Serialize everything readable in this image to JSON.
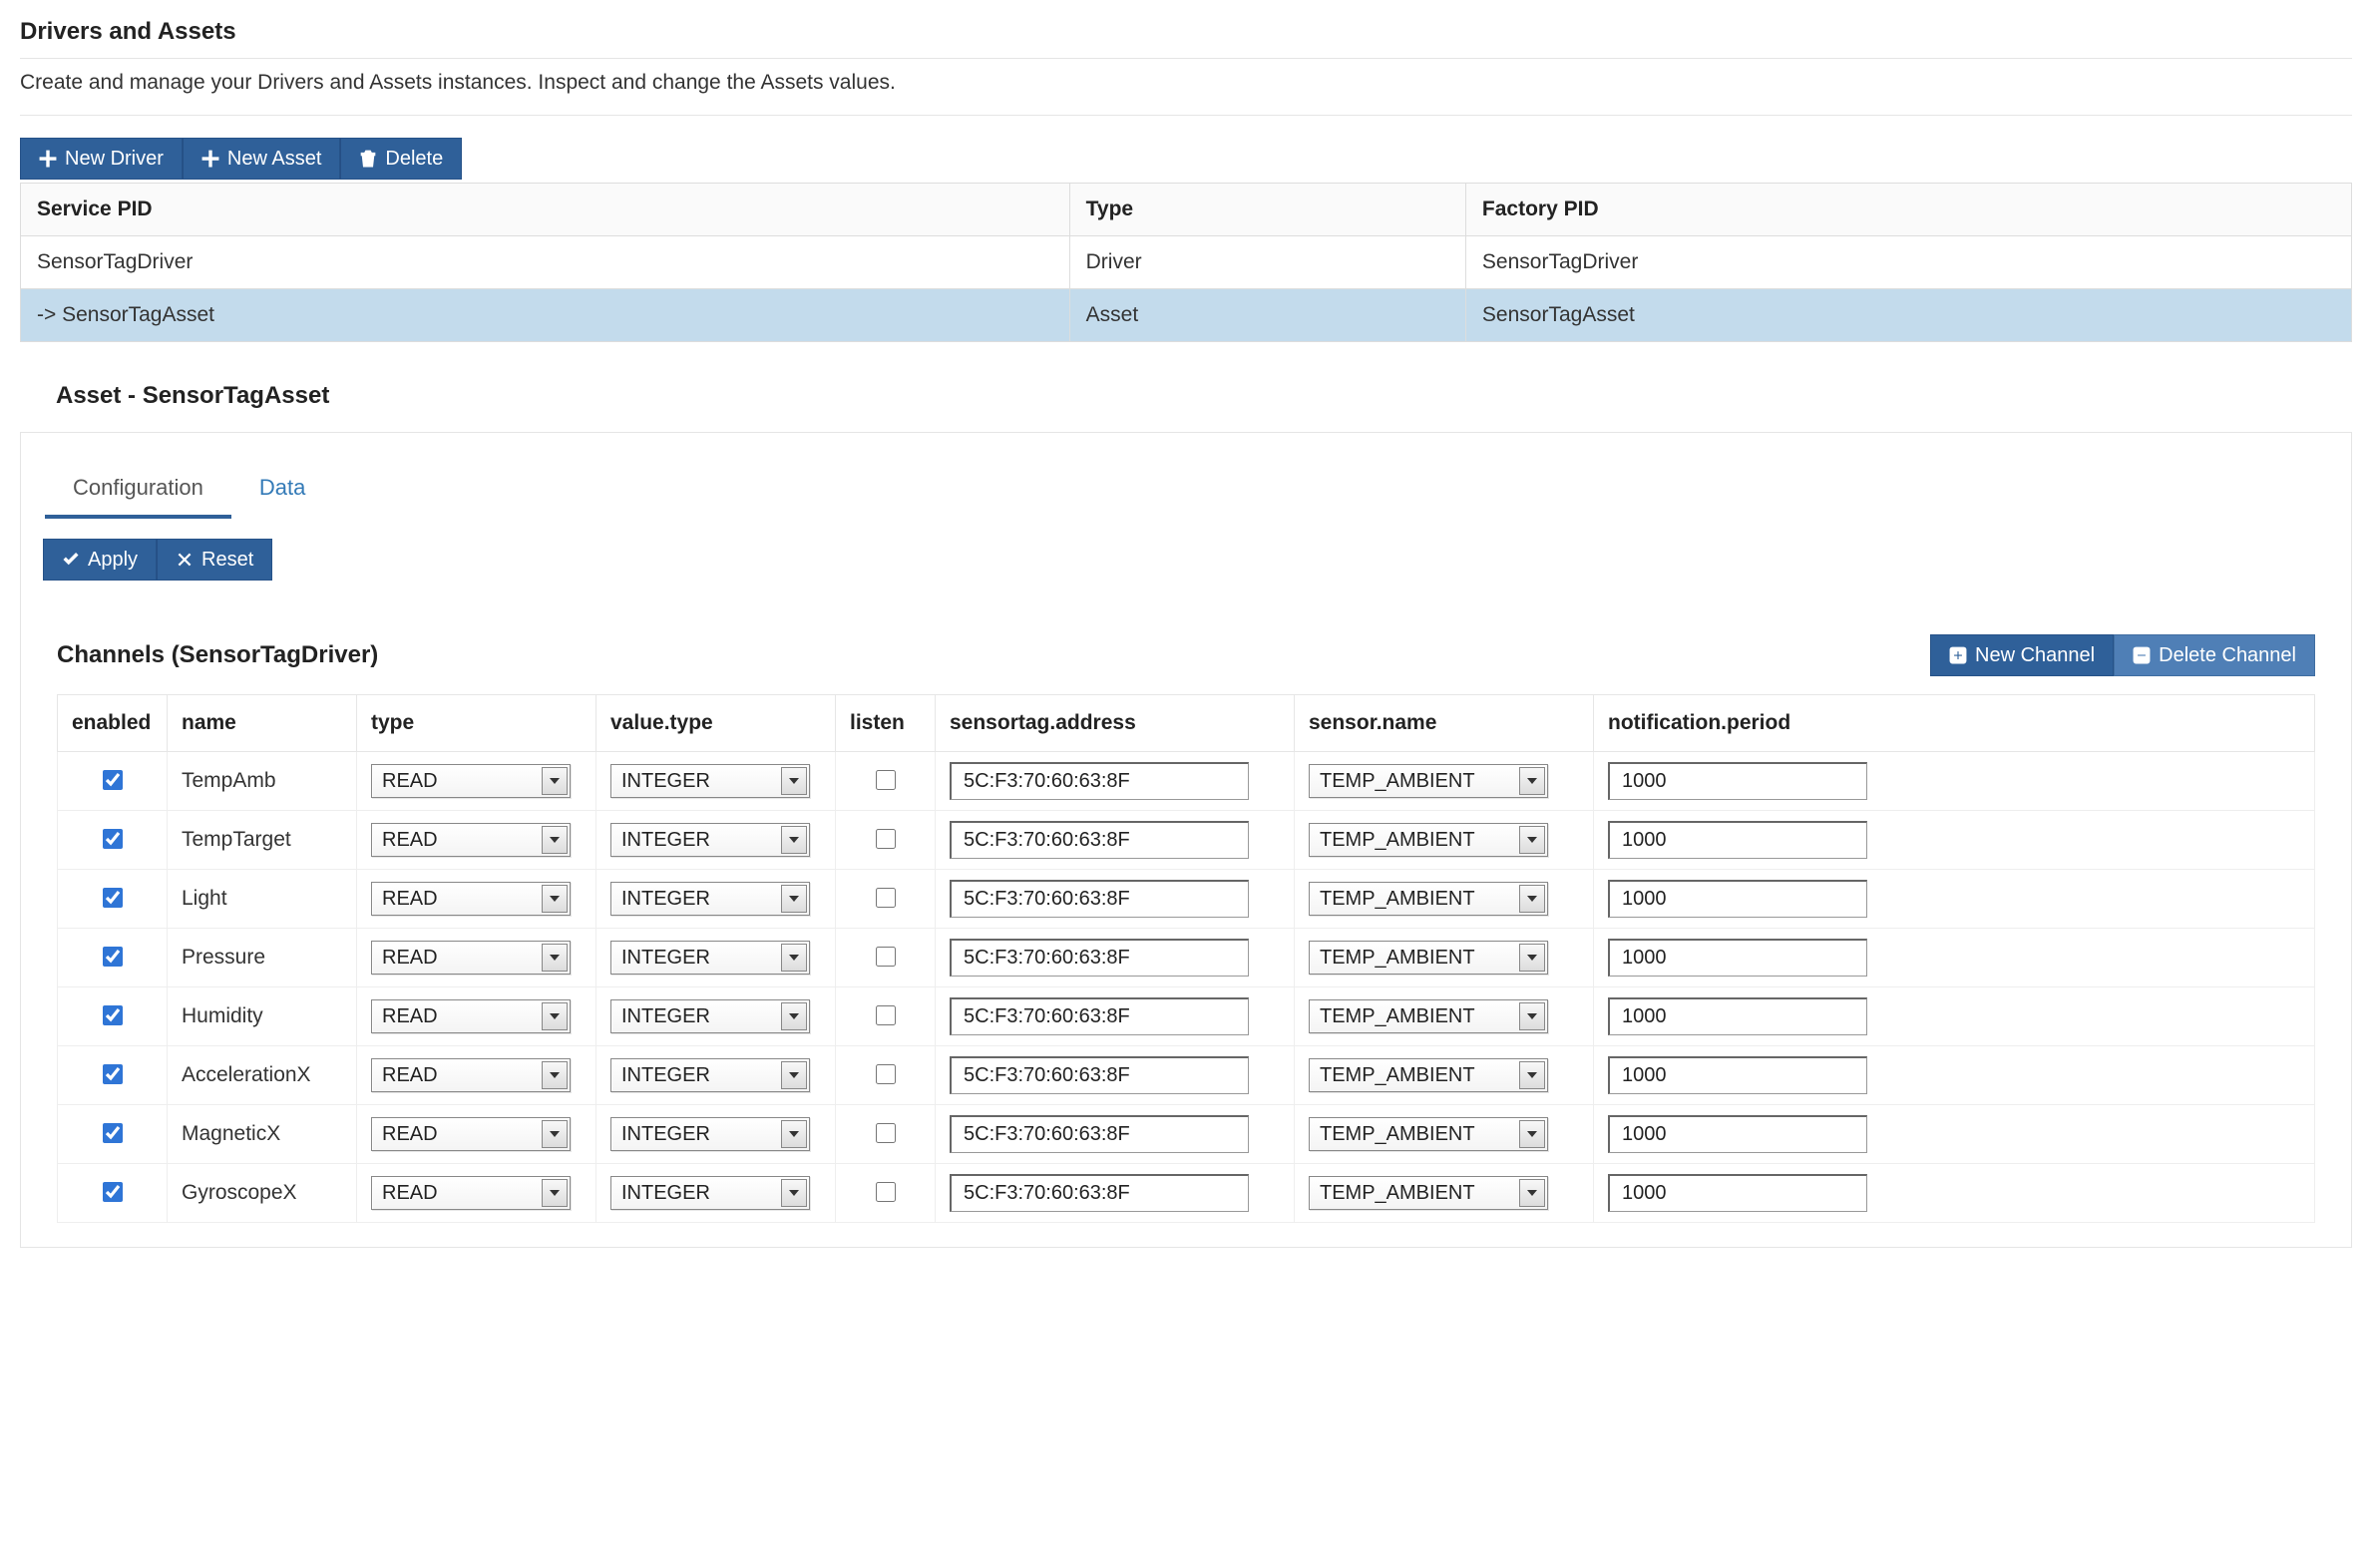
{
  "header": {
    "title": "Drivers and Assets",
    "description": "Create and manage your Drivers and Assets instances. Inspect and change the Assets values."
  },
  "toolbar": {
    "new_driver": "New Driver",
    "new_asset": "New Asset",
    "delete": "Delete"
  },
  "instances_table": {
    "headers": {
      "service_pid": "Service PID",
      "type": "Type",
      "factory_pid": "Factory PID"
    },
    "rows": [
      {
        "service_pid": "SensorTagDriver",
        "type": "Driver",
        "factory_pid": "SensorTagDriver",
        "selected": false
      },
      {
        "service_pid": "-> SensorTagAsset",
        "type": "Asset",
        "factory_pid": "SensorTagAsset",
        "selected": true
      }
    ]
  },
  "asset_panel": {
    "title": "Asset - SensorTagAsset",
    "tabs": {
      "configuration": "Configuration",
      "data": "Data",
      "active": "configuration"
    },
    "actions": {
      "apply": "Apply",
      "reset": "Reset"
    },
    "channels_title": "Channels (SensorTagDriver)",
    "channel_actions": {
      "new": "New Channel",
      "delete": "Delete Channel"
    },
    "channel_headers": {
      "enabled": "enabled",
      "name": "name",
      "type": "type",
      "value_type": "value.type",
      "listen": "listen",
      "address": "sensortag.address",
      "sensor_name": "sensor.name",
      "period": "notification.period"
    },
    "channels": [
      {
        "enabled": true,
        "name": "TempAmb",
        "type": "READ",
        "value_type": "INTEGER",
        "listen": false,
        "address": "5C:F3:70:60:63:8F",
        "sensor_name": "TEMP_AMBIENT",
        "period": "1000"
      },
      {
        "enabled": true,
        "name": "TempTarget",
        "type": "READ",
        "value_type": "INTEGER",
        "listen": false,
        "address": "5C:F3:70:60:63:8F",
        "sensor_name": "TEMP_AMBIENT",
        "period": "1000"
      },
      {
        "enabled": true,
        "name": "Light",
        "type": "READ",
        "value_type": "INTEGER",
        "listen": false,
        "address": "5C:F3:70:60:63:8F",
        "sensor_name": "TEMP_AMBIENT",
        "period": "1000"
      },
      {
        "enabled": true,
        "name": "Pressure",
        "type": "READ",
        "value_type": "INTEGER",
        "listen": false,
        "address": "5C:F3:70:60:63:8F",
        "sensor_name": "TEMP_AMBIENT",
        "period": "1000"
      },
      {
        "enabled": true,
        "name": "Humidity",
        "type": "READ",
        "value_type": "INTEGER",
        "listen": false,
        "address": "5C:F3:70:60:63:8F",
        "sensor_name": "TEMP_AMBIENT",
        "period": "1000"
      },
      {
        "enabled": true,
        "name": "AccelerationX",
        "type": "READ",
        "value_type": "INTEGER",
        "listen": false,
        "address": "5C:F3:70:60:63:8F",
        "sensor_name": "TEMP_AMBIENT",
        "period": "1000"
      },
      {
        "enabled": true,
        "name": "MagneticX",
        "type": "READ",
        "value_type": "INTEGER",
        "listen": false,
        "address": "5C:F3:70:60:63:8F",
        "sensor_name": "TEMP_AMBIENT",
        "period": "1000"
      },
      {
        "enabled": true,
        "name": "GyroscopeX",
        "type": "READ",
        "value_type": "INTEGER",
        "listen": false,
        "address": "5C:F3:70:60:63:8F",
        "sensor_name": "TEMP_AMBIENT",
        "period": "1000"
      }
    ]
  },
  "colors": {
    "primary": "#2f6099",
    "primary_light": "#4f7fb6",
    "selection": "#c3dbec"
  }
}
